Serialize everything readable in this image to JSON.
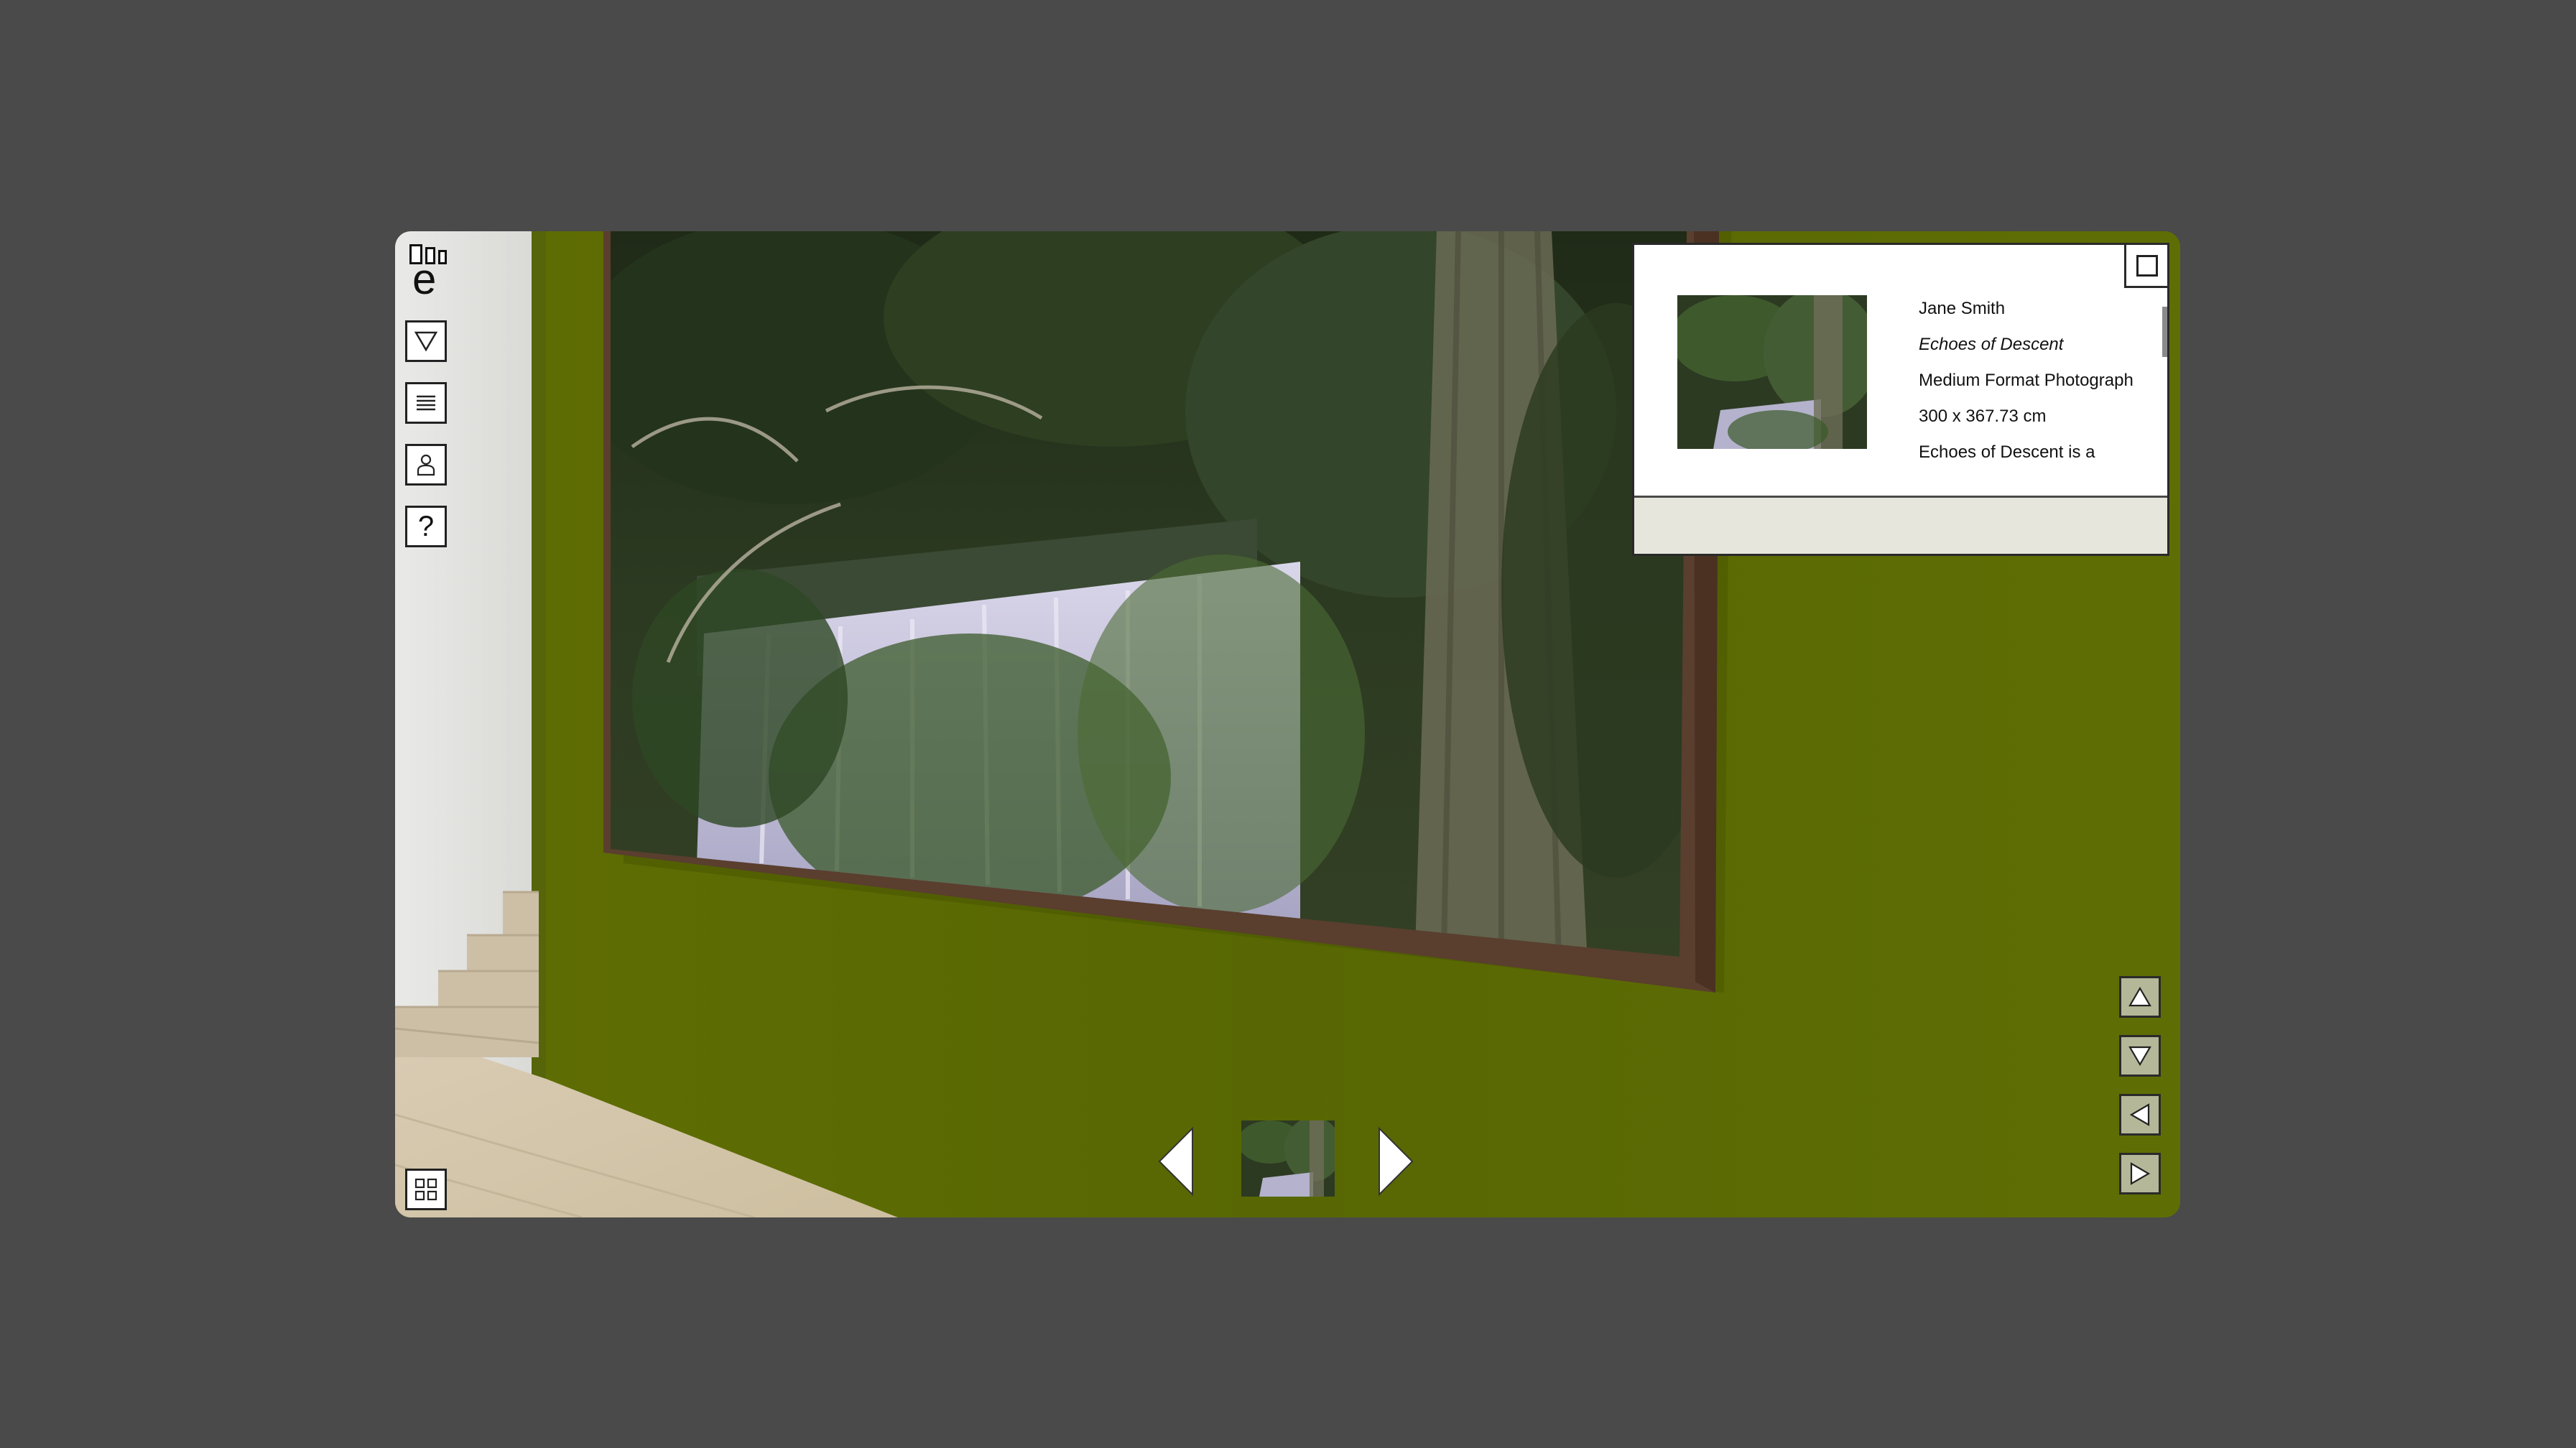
{
  "toolbar": {
    "logo_letter": "e",
    "buttons": [
      {
        "name": "collapse",
        "icon": "triangle-down-icon"
      },
      {
        "name": "menu",
        "icon": "hamburger-icon"
      },
      {
        "name": "profile",
        "icon": "person-icon"
      },
      {
        "name": "help",
        "icon": "question-icon",
        "label": "?"
      }
    ],
    "grid_icon": "grid-icon"
  },
  "artwork": {
    "artist": "Jane Smith",
    "title": "Echoes of Descent",
    "medium": "Medium Format Photograph",
    "dimensions": "300 x 367.73 cm",
    "description": "Echoes of Descent is a"
  },
  "navigation": {
    "prev_icon": "arrow-left-icon",
    "next_icon": "arrow-right-icon",
    "right_controls": [
      "arrow-up-icon",
      "arrow-down-icon",
      "arrow-left-icon",
      "arrow-right-icon"
    ]
  },
  "colors": {
    "wall": "#5d6c02",
    "frame": "#5a3e2e",
    "background": "#4a4a4a",
    "control_fill": "#b5b898"
  }
}
